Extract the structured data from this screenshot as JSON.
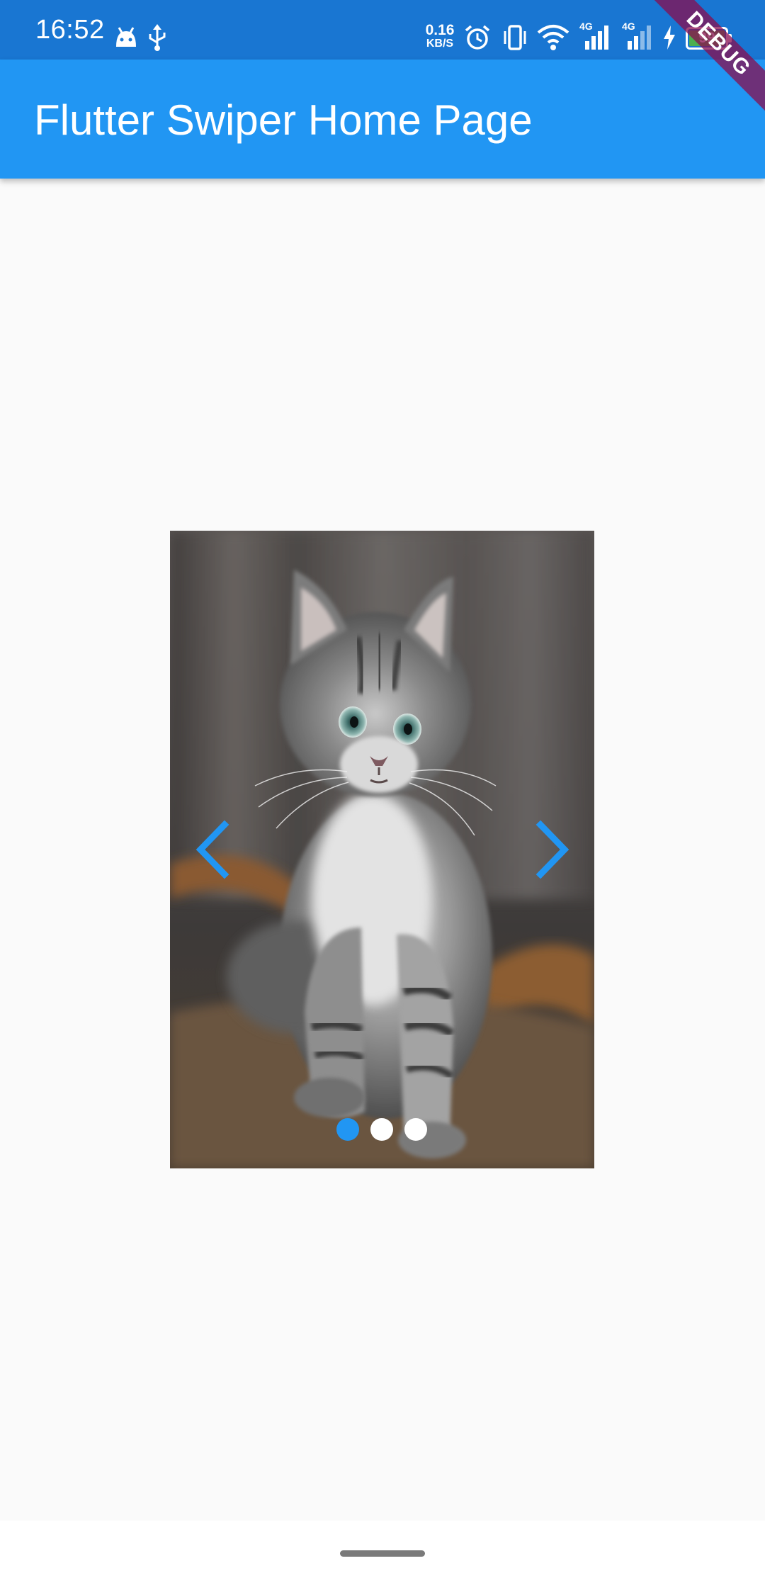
{
  "status_bar": {
    "time": "16:52",
    "net_speed_value": "0.16",
    "net_speed_unit": "KB/S",
    "network_1": "4G",
    "network_2": "4G",
    "battery": "99",
    "icons": [
      "android-icon",
      "usb-icon",
      "alarm-icon",
      "vibrate-icon",
      "wifi-icon",
      "signal-icon",
      "signal-icon",
      "charging-icon",
      "battery-icon"
    ]
  },
  "app_bar": {
    "title": "Flutter Swiper Home Page"
  },
  "debug_banner": {
    "label": "DEBUG"
  },
  "swiper": {
    "image": "kitten-photo",
    "page_count": 3,
    "active_index": 0,
    "prev_icon": "chevron-left-icon",
    "next_icon": "chevron-right-icon"
  },
  "colors": {
    "status_bar": "#1976d2",
    "app_bar": "#2196f3",
    "background": "#fafafa",
    "accent": "#2196f3",
    "debug_banner": "#880e4f"
  }
}
